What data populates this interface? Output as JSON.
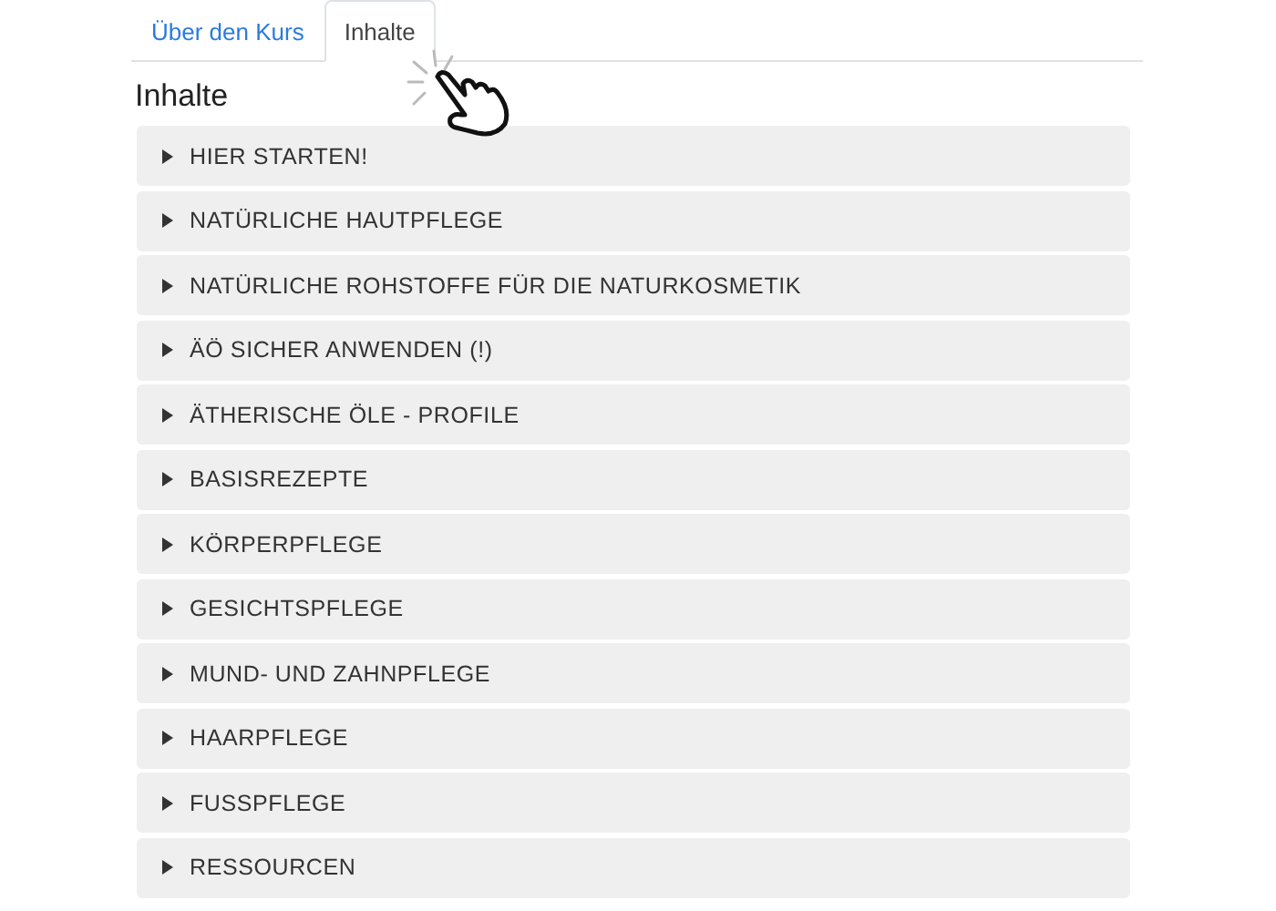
{
  "tabs": [
    {
      "label": "Über den Kurs",
      "selected": false
    },
    {
      "label": "Inhalte",
      "selected": true
    }
  ],
  "heading": "Inhalte",
  "sections": [
    {
      "title": "HIER STARTEN!",
      "expanded": false
    },
    {
      "title": "NATÜRLICHE HAUTPFLEGE",
      "expanded": false
    },
    {
      "title": "NATÜRLICHE ROHSTOFFE FÜR DIE NATURKOSMETIK",
      "expanded": false
    },
    {
      "title": "ÄÖ SICHER ANWENDEN (!)",
      "expanded": false
    },
    {
      "title": "ÄTHERISCHE ÖLE - PROFILE",
      "expanded": false
    },
    {
      "title": "BASISREZEPTE",
      "expanded": false
    },
    {
      "title": "KÖRPERPFLEGE",
      "expanded": false
    },
    {
      "title": "GESICHTSPFLEGE",
      "expanded": false
    },
    {
      "title": "MUND- UND ZAHNPFLEGE",
      "expanded": false
    },
    {
      "title": "HAARPFLEGE",
      "expanded": false
    },
    {
      "title": "FUSSPFLEGE",
      "expanded": false
    },
    {
      "title": "RESSOURCEN",
      "expanded": false
    }
  ]
}
